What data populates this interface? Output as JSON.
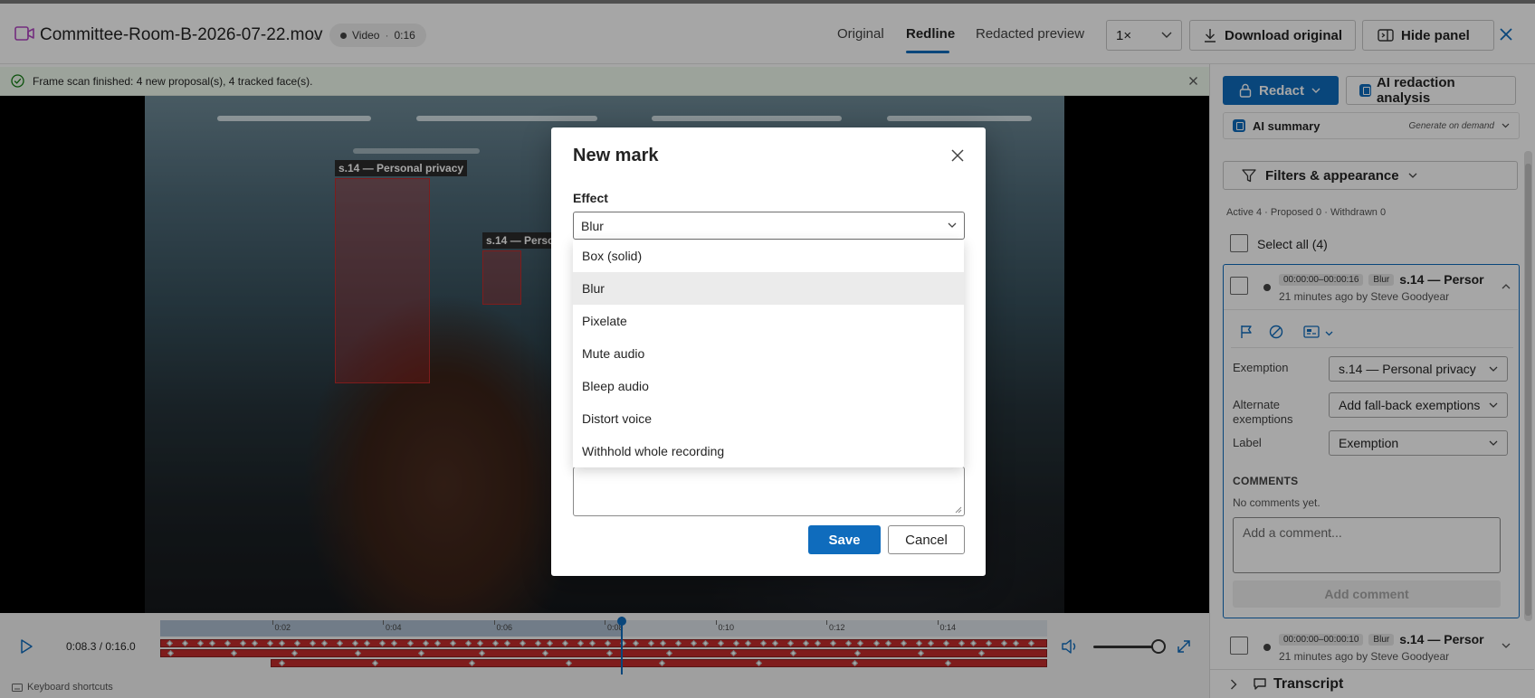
{
  "header": {
    "file_name": "Committee-Room-B-2026-07-22.mov",
    "media_pill": {
      "type": "Video",
      "separator": "·",
      "duration": "0:16"
    },
    "tabs": [
      {
        "label": "Original"
      },
      {
        "label": "Redline"
      },
      {
        "label": "Redacted preview"
      }
    ],
    "active_tab": "Redline",
    "speed": "1×",
    "download_label": "Download original",
    "hide_panel_label": "Hide panel"
  },
  "notice": {
    "text": "Frame scan finished: 4 new proposal(s), 4 tracked face(s)."
  },
  "video": {
    "marks": [
      {
        "label": "s.14 — Personal privacy"
      },
      {
        "label": "s.14 — Perso"
      }
    ]
  },
  "player": {
    "timecode": "0:08.3 / 0:16.0",
    "playhead_fraction": 0.519,
    "volume_fraction": 1.0,
    "ticks": [
      "0:02",
      "0:04",
      "0:06",
      "0:08",
      "0:10",
      "0:12",
      "0:14"
    ],
    "keyboard_shortcuts": "Keyboard shortcuts"
  },
  "modal": {
    "title": "New mark",
    "effect_label": "Effect",
    "effect_value": "Blur",
    "effect_options": [
      "Box (solid)",
      "Blur",
      "Pixelate",
      "Mute audio",
      "Bleep audio",
      "Distort voice",
      "Withhold whole recording"
    ],
    "selected_option": "Blur",
    "save_label": "Save",
    "cancel_label": "Cancel"
  },
  "panel": {
    "redact_label": "Redact",
    "ai_analysis_label": "AI redaction analysis",
    "ai_summary_label": "AI summary",
    "ai_summary_hint": "Generate on demand",
    "filters_label": "Filters & appearance",
    "counts": "Active 4 · Proposed 0 · Withdrawn 0",
    "select_all": "Select all (4)",
    "marks": [
      {
        "time_range": "00:00:00–00:00:16",
        "effect": "Blur",
        "title": "s.14 — Persor",
        "meta": "21 minutes ago by Steve Goodyear"
      },
      {
        "time_range": "00:00:00–00:00:10",
        "effect": "Blur",
        "title": "s.14 — Persor",
        "meta": "21 minutes ago by Steve Goodyear"
      }
    ],
    "detail": {
      "exemption_label": "Exemption",
      "exemption_value": "s.14 — Personal privacy",
      "alternate_label": "Alternate exemptions",
      "alternate_placeholder": "Add fall-back exemptions",
      "label_label": "Label",
      "label_value": "Exemption",
      "comments_heading": "COMMENTS",
      "no_comments": "No comments yet.",
      "comment_placeholder": "Add a comment...",
      "add_comment_label": "Add comment"
    },
    "transcript_label": "Transcript"
  },
  "colors": {
    "accent": "#0f6cbd",
    "mark_red": "#c42b2b",
    "notice_bg": "#f0fbef",
    "success_icon": "#107c10"
  }
}
